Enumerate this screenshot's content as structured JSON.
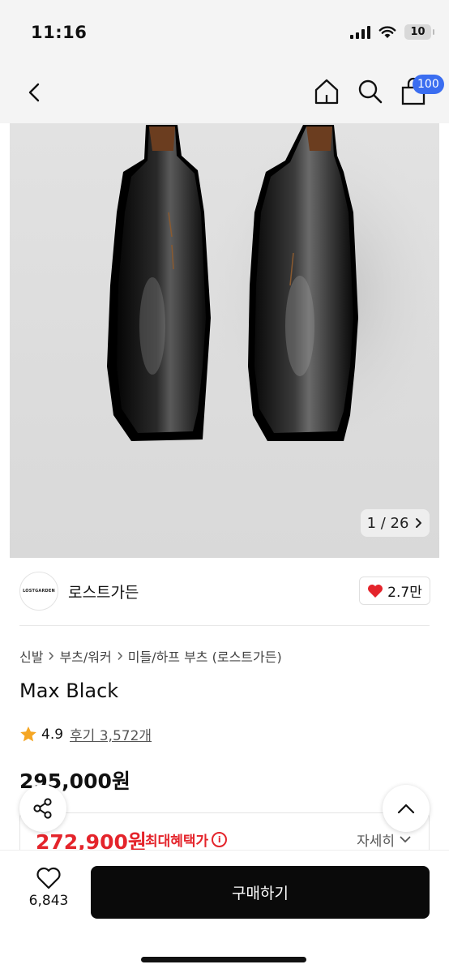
{
  "status_bar": {
    "time": "11:16",
    "battery": "10"
  },
  "header": {
    "back_icon": "chevron-left-icon",
    "home_icon": "home-icon",
    "search_icon": "search-icon",
    "cart_icon": "cart-icon",
    "cart_badge": "100"
  },
  "gallery": {
    "counter": "1 / 26"
  },
  "brand": {
    "logo_text": "LOSTGARDEN",
    "name": "로스트가든",
    "likes": "2.7만"
  },
  "breadcrumb": [
    "신발",
    "부츠/워커",
    "미들/하프 부츠 (로스트가든)"
  ],
  "product": {
    "title": "Max Black",
    "rating": "4.9",
    "reviews": "후기 3,572개",
    "price": "295,000원",
    "sale_price": "272,900원",
    "sale_label": "최대혜택가",
    "detail_toggle": "자세히"
  },
  "bottom_bar": {
    "wish_count": "6,843",
    "buy_label": "구매하기"
  },
  "colors": {
    "accent_red": "#e4242b",
    "badge_blue": "#3a6df0",
    "buy_button": "#0a0a0a",
    "star": "#f5a623"
  }
}
